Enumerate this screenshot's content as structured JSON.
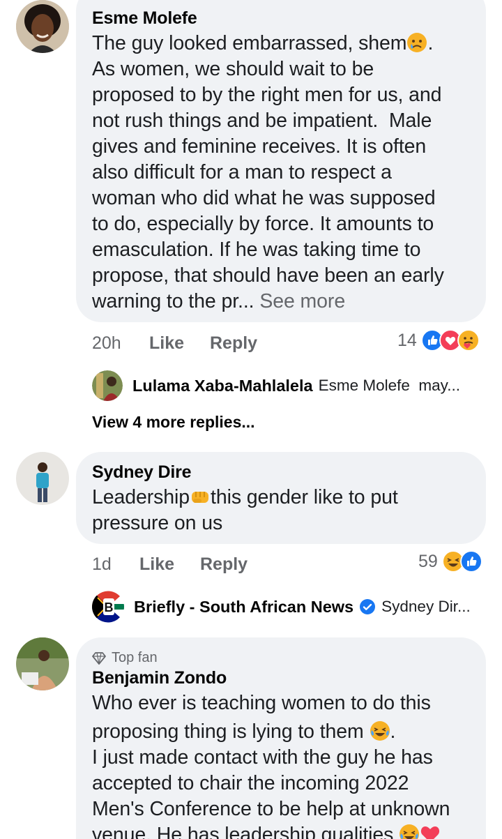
{
  "comments": [
    {
      "author": "Esme Molefe",
      "lines": [
        "The guy looked embarrassed, shem",
        "As women, we should wait to be",
        "proposed to by the right men for us, and",
        "not rush things and be impatient.  Male",
        "gives and feminine receives. It is often",
        "also difficult for a man to respect a",
        "woman who did what he was supposed",
        "to do, especially by force. It amounts to",
        "emasculation. If he was taking time to",
        "propose, that should have been an early",
        "warning to the pr..."
      ],
      "line1_suffix": ".",
      "see_more": "See more",
      "time": "20h",
      "like": "Like",
      "reply": "Reply",
      "reaction_count": "14",
      "reactions": [
        "like-icon",
        "love-icon",
        "care-icon"
      ],
      "reply_preview": {
        "name": "Lulama Xaba-Mahlalela",
        "text": "Esme Molefe  may..."
      },
      "more_replies": "View 4 more replies..."
    },
    {
      "author": "Sydney Dire",
      "line1_a": "Leadership",
      "line1_b": "this gender like to put",
      "line2": "pressure on us",
      "time": "1d",
      "like": "Like",
      "reply": "Reply",
      "reaction_count": "59",
      "reactions": [
        "haha-icon",
        "like-icon"
      ],
      "reply_preview": {
        "name": "Briefly - South African News",
        "text": "Sydney Dir..."
      }
    },
    {
      "badge": "Top fan",
      "author": "Benjamin Zondo",
      "lines": [
        "Who ever is teaching women to do this",
        "proposing thing is lying to them",
        "I just made contact with the guy he has",
        "accepted to chair the incoming 2022",
        "Men's Conference to be help at unknown",
        "venue. He has leadership qualities"
      ],
      "line2_suffix": "."
    }
  ],
  "colors": {
    "bubble": "#f0f2f5",
    "meta_text": "#65676b",
    "like_blue": "#1877f2",
    "love_red": "#f33e58",
    "emoji_yellow": "#f7b125"
  }
}
